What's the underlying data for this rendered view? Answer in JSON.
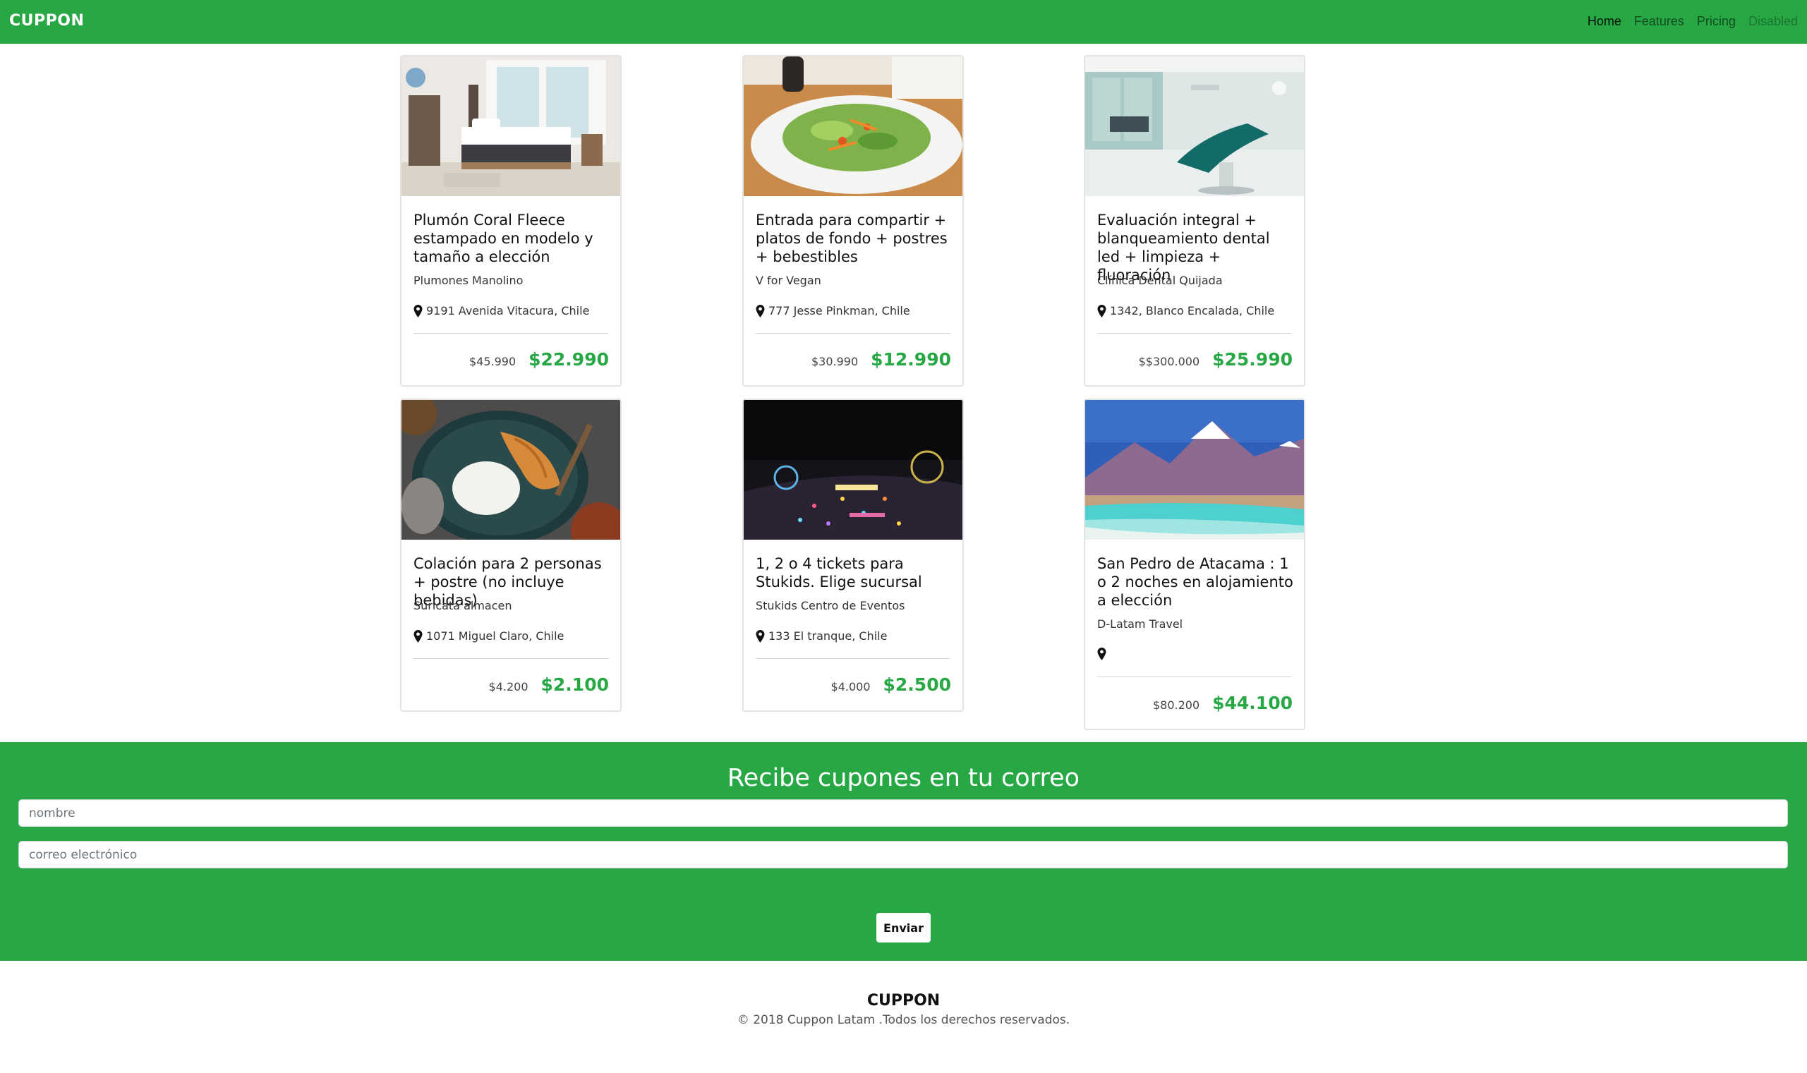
{
  "navbar": {
    "brand": "CUPPON",
    "links": [
      "Home",
      "Features",
      "Pricing",
      "Disabled"
    ]
  },
  "cards": [
    {
      "title": "Plumón Coral Fleece estampado en modelo y tamaño a elección",
      "company": "Plumones Manolino",
      "address": "9191 Avenida Vitacura, Chile",
      "old_price": "$45.990",
      "new_price": "$22.990",
      "image_icon": "bedroom-photo"
    },
    {
      "title": "Entrada para compartir + platos de fondo + postres + bebestibles",
      "company": "V for Vegan",
      "address": "777 Jesse Pinkman, Chile",
      "old_price": "$30.990",
      "new_price": "$12.990",
      "image_icon": "salad-photo"
    },
    {
      "title": "Evaluación integral + blanqueamiento dental led + limpieza + fluoración",
      "company": "Clínica Dental Quijada",
      "address": "1342, Blanco Encalada, Chile",
      "old_price": "$$300.000",
      "new_price": "$25.990",
      "image_icon": "dental-clinic-photo"
    },
    {
      "title": "Colación para 2 personas + postre (no incluye bebidas)",
      "company": "Suricata almacen",
      "address": "1071 Miguel Claro, Chile",
      "old_price": "$4.200",
      "new_price": "$2.100",
      "image_icon": "rice-chicken-photo"
    },
    {
      "title": "1, 2 o 4 tickets para Stukids. Elige sucursal",
      "company": "Stukids Centro de Eventos",
      "address": "133 El tranque, Chile",
      "old_price": "$4.000",
      "new_price": "$2.500",
      "image_icon": "night-fair-photo"
    },
    {
      "title": "San Pedro de Atacama : 1 o 2 noches en alojamiento a elección",
      "company": "D-Latam Travel",
      "address": "",
      "old_price": "$80.200",
      "new_price": "$44.100",
      "image_icon": "atacama-lake-photo"
    }
  ],
  "subscribe": {
    "title": "Recibe cupones en tu correo",
    "name_placeholder": "nombre",
    "email_placeholder": "correo electrónico",
    "button_label": "Enviar"
  },
  "footer": {
    "brand": "CUPPON",
    "copyright": "© 2018 Cuppon Latam .Todos los derechos reservados."
  },
  "colors": {
    "brand_green": "#28a745",
    "white": "#ffffff"
  }
}
